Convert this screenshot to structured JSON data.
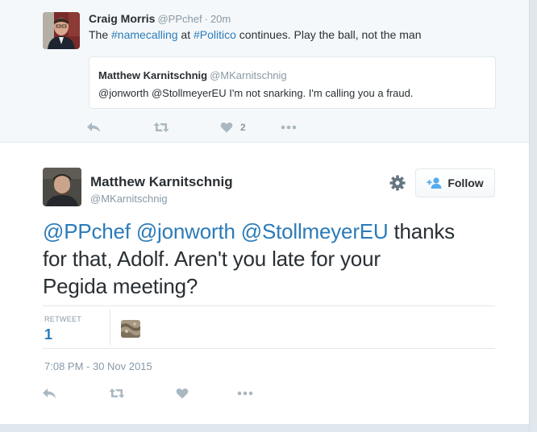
{
  "parent_tweet": {
    "fullname": "Craig Morris",
    "screen_name": "@PPchef",
    "separator": "·",
    "time": "20m",
    "text_parts": [
      "The ",
      "#namecalling",
      " at ",
      "#Politico",
      " continues. Play the ball, not the man"
    ],
    "quoted": {
      "fullname": "Matthew Karnitschnig",
      "screen_name": "@MKarnitschnig",
      "text": "@jonworth @StollmeyerEU I'm not snarking. I'm calling you a fraud."
    },
    "like_count": "2"
  },
  "main_tweet": {
    "fullname": "Matthew Karnitschnig",
    "screen_name": "@MKarnitschnig",
    "follow_label": "Follow",
    "text_lines": [
      {
        "mentions": [
          "@PPchef",
          "@jonworth",
          "@StollmeyerEU"
        ],
        "rest": " thanks"
      },
      {
        "text": "for that, Adolf. Aren't you late for your"
      },
      {
        "text": "Pegida meeting?"
      }
    ],
    "retweet_label": "RETWEET",
    "retweet_count": "1",
    "timestamp": "7:08 PM - 30 Nov 2015"
  },
  "icons": [
    "reply-icon",
    "retweet-icon",
    "like-icon",
    "more-icon",
    "gear-icon",
    "follow-user-icon"
  ],
  "colors": {
    "link": "#2b7bb9",
    "muted": "#8899a6",
    "text": "#292f33",
    "border": "#e1e8ed",
    "parent_bg": "#f5f8fa"
  }
}
